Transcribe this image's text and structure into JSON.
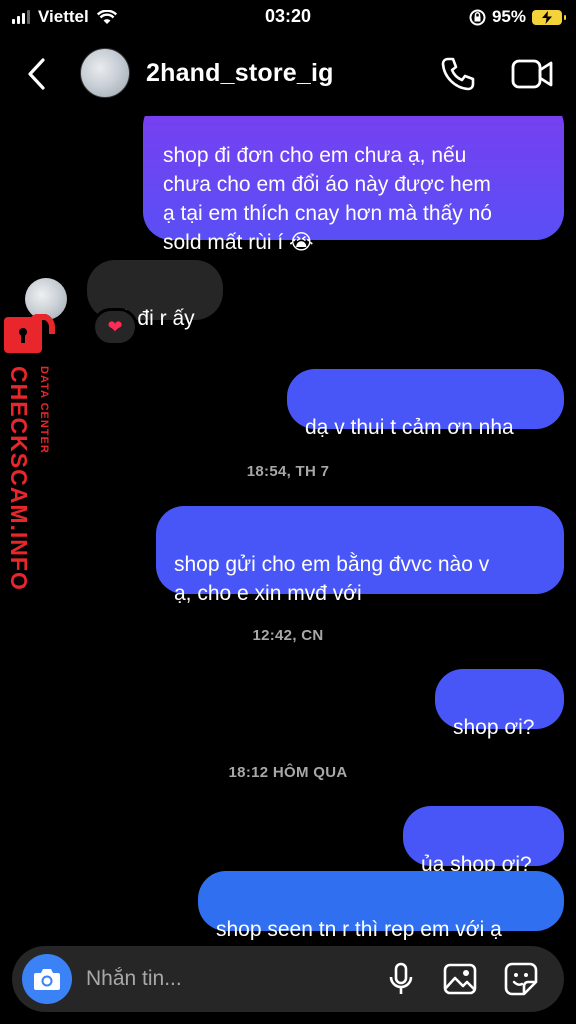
{
  "status_bar": {
    "carrier": "Viettel",
    "time": "03:20",
    "battery": "95%"
  },
  "header": {
    "username": "2hand_store_ig",
    "icons": [
      "back-arrow-icon",
      "phone-icon",
      "video-camera-icon"
    ]
  },
  "messages": [
    {
      "type": "outgoing",
      "text": "shop đi đơn cho em chưa ạ, nếu\nchưa cho em đổi áo này được hem\nạ tại em thích cnay hơn mà thấy nó\nsold mất rùi í 😭"
    },
    {
      "type": "incoming",
      "text": "Tớ đi r ấy",
      "reaction": "❤"
    },
    {
      "type": "outgoing",
      "text": "dạ v thui t cảm ơn nha"
    },
    {
      "type": "timestamp",
      "text": "18:54, TH 7"
    },
    {
      "type": "outgoing",
      "text": "shop gửi cho em bằng đvvc nào v\nạ, cho e xin mvđ với"
    },
    {
      "type": "timestamp",
      "text": "12:42, CN"
    },
    {
      "type": "outgoing",
      "text": "shop ơi?"
    },
    {
      "type": "timestamp",
      "text": "18:12 HÔM QUA"
    },
    {
      "type": "outgoing",
      "text": "ủa shop ơi?"
    },
    {
      "type": "outgoing",
      "text": "shop seen tn r thì rep em với ạ"
    }
  ],
  "composer": {
    "placeholder": "Nhắn tin...",
    "icons": [
      "camera-icon",
      "microphone-icon",
      "gallery-icon",
      "sticker-icon"
    ]
  },
  "watermark": {
    "main": "CHECKSCAM.INFO",
    "sub": "DATA CENTER",
    "color": "#e8262b"
  },
  "colors": {
    "outgoing_purple": "#7a3ef0",
    "outgoing_blue": "#4856f7",
    "incoming": "#262626",
    "camera_button": "#3b82f6"
  }
}
